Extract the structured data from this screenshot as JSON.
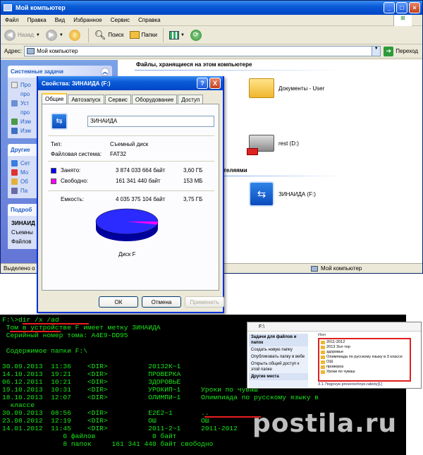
{
  "explorer": {
    "title": "Мой компьютер",
    "menu": [
      "Файл",
      "Правка",
      "Вид",
      "Избранное",
      "Сервис",
      "Справка"
    ],
    "toolbar": {
      "back": "Назад",
      "search": "Поиск",
      "folders": "Папки"
    },
    "address_label": "Адрес:",
    "address_value": "Мой компьютер",
    "go_label": "Переход",
    "left_panels": [
      {
        "title": "Системные задачи",
        "items": [
          "Про",
          "про",
          "Уст",
          "про",
          "Изм",
          "Изм"
        ]
      },
      {
        "title": "Другие",
        "items": [
          "Сет",
          "Мо",
          "Об",
          "Па"
        ]
      },
      {
        "title": "Подроб",
        "details": [
          "ЗИНАИД",
          "Съемны",
          "Файлов"
        ]
      }
    ],
    "section_stored": "Файлы, хранящиеся на этом компьютере",
    "section_removable": "теляями",
    "items": {
      "documents": "Документы - User",
      "rest_drive": "rest (D:)",
      "flash_drive": "ЗИНАИДА (F:)"
    },
    "status_left": "Выделено о",
    "status_right": "Мой компьютер"
  },
  "dialog": {
    "title": "Свойства: ЗИНАИДА (F:)",
    "help_button": "?",
    "close_button": "X",
    "tabs": [
      "Общие",
      "Автозапуск",
      "Сервис",
      "Оборудование",
      "Доступ"
    ],
    "active_tab": "Общие",
    "drive_name": "ЗИНАИДА",
    "type_label": "Тип:",
    "type_value": "Съемный диск",
    "fs_label": "Файловая система:",
    "fs_value": "FAT32",
    "used_label": "Занято:",
    "used_bytes": "3 874 033 664 байт",
    "used_gb": "3,60 ГБ",
    "free_label": "Свободно:",
    "free_bytes": "161 341 440 байт",
    "free_mb": "153 МБ",
    "capacity_label": "Емкость:",
    "capacity_bytes": "4 035 375 104 байт",
    "capacity_gb": "3,75 ГБ",
    "disk_label": "Диск F",
    "used_fraction": 0.96,
    "colors": {
      "used": "#0000ff",
      "free": "#ff00ff"
    },
    "buttons": {
      "ok": "ОК",
      "cancel": "Отмена",
      "apply": "Применить"
    }
  },
  "console": {
    "lines": [
      "F:\\>dir /x /ad",
      " Том в устройстве F имеет метку ЗИНАИДА",
      " Серийный номер тома: A4E9-DD95",
      "",
      " Содержимое папки F:\\",
      "",
      "30.09.2013  11:36    <DIR>          20132К~1",
      "14.10.2013  19:21    <DIR>          ПРОВЕРКА",
      "06.12.2011  10:21    <DIR>          ЗДОРОВЬЕ",
      "19.10.2013  10:31    <DIR>          УРОКИП~1     Уроки по чуваш",
      "18.10.2013  12:07    <DIR>          ОЛИМПИ~1     Олимпиада по русскому языку в",
      "  классе",
      "30.09.2013  08:56    <DIR>          E2E2~1       ..",
      "23.08.2012  12:19    <DIR>          ОШ           ОШ",
      "14.01.2012  11:45    <DIR>          2011-2~1     2011-2012",
      "               0 файлов              0 байт",
      "               8 папок     161 341 440 байт свободно"
    ]
  },
  "inset": {
    "address": "F:\\",
    "left_header": "Задачи для файлов и папок",
    "left_items": [
      "Создать новую папку",
      "Опубликовать папку в вебе",
      "Открыть общий доступ к этой папке",
      "Другие места"
    ],
    "list_header": "Имя",
    "folders": [
      "2011-2012",
      "2013 Зол тер",
      "здоровье",
      "Олимпиада по русскому языку в 3 классе",
      "ОШ",
      "проверка",
      "Уроки по чуваш"
    ],
    "extra_file": "3.1.7togovye.proverochnye.raboty[1]"
  },
  "watermark": "postila.ru"
}
